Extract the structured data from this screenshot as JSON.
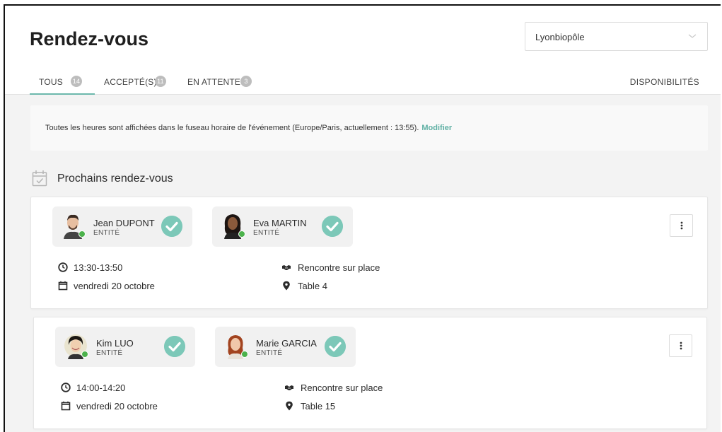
{
  "header": {
    "title": "Rendez-vous",
    "location_select": {
      "value": "Lyonbiopôle"
    }
  },
  "tabs": [
    {
      "label": "TOUS",
      "count": "14",
      "active": true
    },
    {
      "label": "ACCEPTÉ(S)",
      "count": "11",
      "active": false
    },
    {
      "label": "EN ATTENTE",
      "count": "3",
      "active": false
    }
  ],
  "availability_tab": "DISPONIBILITÉS",
  "notice": {
    "text": "Toutes les heures sont affichées dans le fuseau horaire de l'événement (Europe/Paris, actuellement : 13:55).",
    "link": "Modifier"
  },
  "section": {
    "title": "Prochains rendez-vous",
    "icon": "calendar-check-icon"
  },
  "meetings": [
    {
      "participants": [
        {
          "name": "Jean DUPONT",
          "role": "ENTITÉ",
          "status": "accepted"
        },
        {
          "name": "Eva MARTIN",
          "role": "ENTITÉ",
          "status": "accepted"
        }
      ],
      "time": "13:30-13:50",
      "date": "vendredi 20 octobre",
      "type": "Rencontre sur place",
      "location": "Table 4"
    },
    {
      "participants": [
        {
          "name": "Kim LUO",
          "role": "ENTITÉ",
          "status": "accepted"
        },
        {
          "name": "Marie GARCIA",
          "role": "ENTITÉ",
          "status": "accepted"
        }
      ],
      "time": "14:00-14:20",
      "date": "vendredi 20 octobre",
      "type": "Rencontre sur place",
      "location": "Table 15"
    }
  ],
  "colors": {
    "accent": "#6cb8ac",
    "check": "#7cc8b8",
    "online": "#4cb24c",
    "background": "#f3f3f3"
  }
}
